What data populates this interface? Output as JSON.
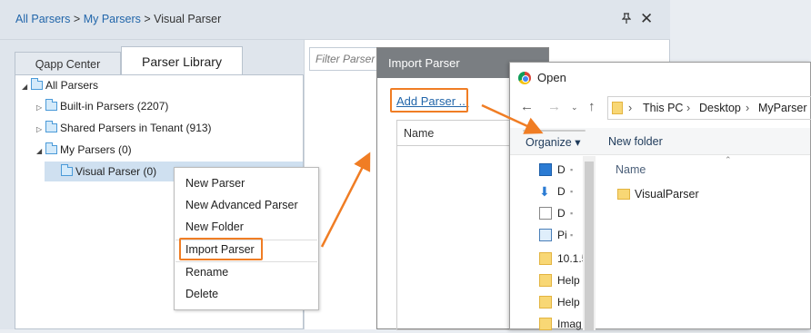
{
  "breadcrumb": {
    "item1": "All Parsers",
    "sep1": " > ",
    "item2": "My Parsers",
    "sep2": " > ",
    "current": "Visual Parser"
  },
  "window": {
    "pin_icon": "pin-icon",
    "close_icon": "close-icon",
    "close_glyph": "✕",
    "pin_glyph": "🖈"
  },
  "tabs": [
    {
      "label": "Qapp Center"
    },
    {
      "label": "Parser Library"
    }
  ],
  "filter": {
    "placeholder": "Filter Parser"
  },
  "tree": [
    {
      "label": "All Parsers",
      "caret": "◢"
    },
    {
      "label": "Built-in Parsers (2207)",
      "caret": "▷"
    },
    {
      "label": "Shared Parsers in Tenant (913)",
      "caret": "▷"
    },
    {
      "label": "My Parsers (0)",
      "caret": "◢"
    },
    {
      "label": "Visual Parser (0)",
      "caret": ""
    }
  ],
  "context_menu": [
    {
      "label": "New Parser"
    },
    {
      "label": "New Advanced Parser"
    },
    {
      "label": "New Folder"
    },
    {
      "label": "Import Parser"
    },
    {
      "label": "Rename"
    },
    {
      "label": "Delete"
    }
  ],
  "import_dialog": {
    "title": "Import Parser",
    "add_link": "Add Parser ...",
    "column": "Name"
  },
  "open_dialog": {
    "title": "Open",
    "address": [
      "This PC",
      "Desktop",
      "MyParser"
    ],
    "address_sep": "›",
    "toolbar": {
      "organize": "Organize ▾",
      "new_folder": "New folder"
    },
    "nav_items": [
      {
        "label": "D",
        "icon": "desktop-icon"
      },
      {
        "label": "D",
        "icon": "downloads-icon"
      },
      {
        "label": "D",
        "icon": "documents-icon"
      },
      {
        "label": "Pi",
        "icon": "pictures-icon"
      },
      {
        "label": "10.1.5",
        "icon": "folder-icon"
      },
      {
        "label": "Help",
        "icon": "folder-icon"
      },
      {
        "label": "Help",
        "icon": "folder-icon"
      },
      {
        "label": "Imag",
        "icon": "folder-icon"
      }
    ],
    "files_header": "Name",
    "files": [
      {
        "label": "VisualParser"
      }
    ]
  },
  "accent_color": "#f07d24"
}
